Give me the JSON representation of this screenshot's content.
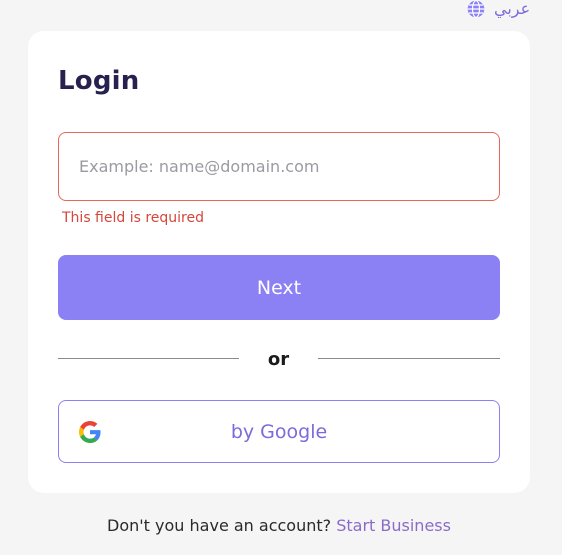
{
  "language_switch": {
    "label": "عربي",
    "icon": "globe-icon"
  },
  "login": {
    "title": "Login",
    "email_placeholder": "Example: name@domain.com",
    "email_value": "",
    "error_message": "This field is required",
    "next_label": "Next",
    "divider_label": "or",
    "google_label": "by Google",
    "google_icon": "google-icon"
  },
  "footer": {
    "prompt": "Don't you have an account?",
    "link_label": "Start Business"
  },
  "colors": {
    "accent": "#8c80f5",
    "title": "#27214f",
    "error": "#d4473b",
    "link": "#8a6cc8",
    "background": "#f6f5f5"
  }
}
